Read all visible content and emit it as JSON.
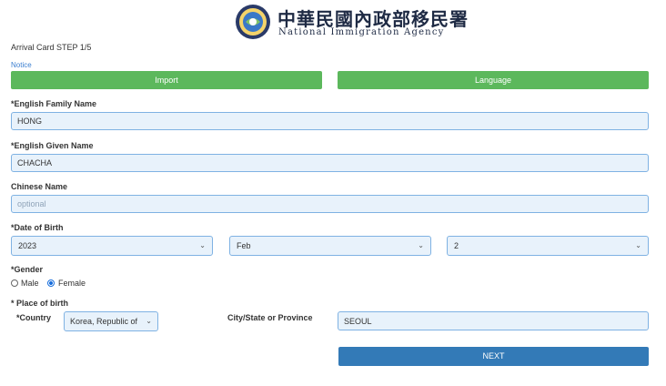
{
  "header": {
    "agency_name_zh": "中華民國內政部移民署",
    "agency_name_en": "National Immigration Agency"
  },
  "form": {
    "step_title": "Arrival Card STEP 1/5",
    "notice_link": "Notice",
    "import_button": "Import",
    "language_button": "Language",
    "family_name": {
      "label": "*English Family Name",
      "value": "HONG"
    },
    "given_name": {
      "label": "*English Given Name",
      "value": "CHACHA"
    },
    "chinese_name": {
      "label": "Chinese Name",
      "value": "",
      "placeholder": "optional"
    },
    "date_of_birth": {
      "label": "*Date of Birth",
      "year": "2023",
      "month": "Feb",
      "day": "2"
    },
    "gender": {
      "label": "*Gender",
      "options": [
        {
          "label": "Male",
          "selected": false
        },
        {
          "label": "Female",
          "selected": true
        }
      ]
    },
    "place_of_birth": {
      "label": "* Place of birth",
      "country_label": "*Country",
      "country_value": "Korea, Republic of",
      "city_label": "City/State or Province",
      "city_value": "SEOUL"
    },
    "next_button": "NEXT"
  },
  "colors": {
    "green_button": "#5cb85c",
    "next_button": "#337ab7",
    "input_border": "#7fb2e3",
    "input_bg": "#e8f2fb",
    "link": "#3c7fd0"
  }
}
